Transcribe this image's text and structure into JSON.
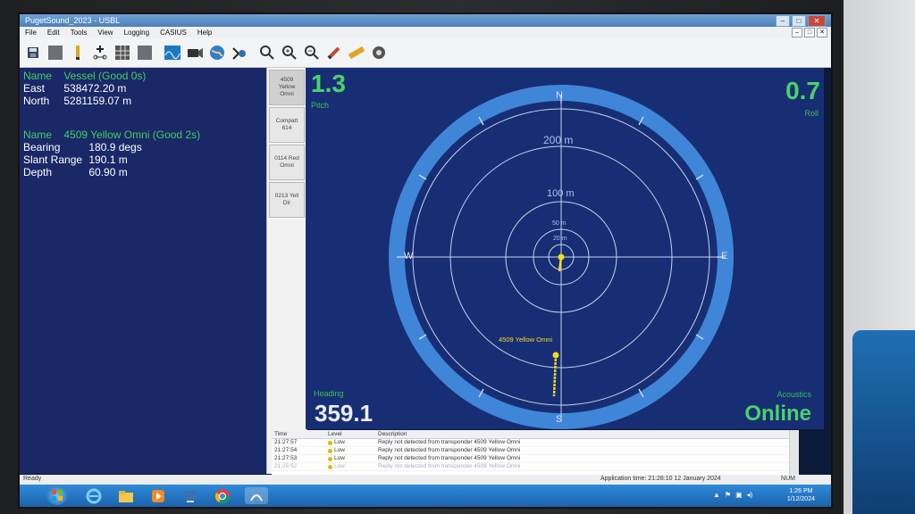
{
  "window": {
    "title": "PugetSound_2023 - USBL",
    "controls": {
      "minimize": "–",
      "maximize": "□",
      "close": "✕"
    }
  },
  "menu": [
    "File",
    "Edit",
    "Tools",
    "View",
    "Logging",
    "CASIUS",
    "Help"
  ],
  "toolbar_icons": [
    "save-icon",
    "blank-icon",
    "marker-icon",
    "add-node-icon",
    "grid-icon",
    "blank-icon",
    "wave-icon",
    "camera-icon",
    "globe-icon",
    "fish-icon",
    "zoom-in-icon",
    "zoom-fit-icon",
    "zoom-out-icon",
    "pen-icon",
    "ruler-icon",
    "target-icon"
  ],
  "vessel": {
    "name_label": "Name",
    "name_value": "Vessel (Good 0s)",
    "east_label": "East",
    "east_value": "538472.20 m",
    "north_label": "North",
    "north_value": "5281159.07 m"
  },
  "transponder": {
    "name_label": "Name",
    "name_value": "4509 Yellow Omni (Good 2s)",
    "bearing_label": "Bearing",
    "bearing_value": "180.9 degs",
    "slant_label": "Slant Range",
    "slant_value": "190.1 m",
    "depth_label": "Depth",
    "depth_value": "60.90 m"
  },
  "transponder_tabs": [
    {
      "line1": "4509",
      "line2": "Yellow",
      "line3": "Omni"
    },
    {
      "line1": "Compatt",
      "line2": "614",
      "line3": ""
    },
    {
      "line1": "0114 Red",
      "line2": "Omni",
      "line3": ""
    },
    {
      "line1": "0213 Yell",
      "line2": "Dir",
      "line3": ""
    }
  ],
  "readouts": {
    "pitch_value": "1.3",
    "pitch_label": "Pitch",
    "roll_value": "0.7",
    "roll_label": "Roll",
    "heading_label": "Heading",
    "heading_value": "359.1",
    "acoustics_label": "Acoustics",
    "acoustics_value": "Online"
  },
  "compass": {
    "n": "N",
    "s": "S",
    "e": "E",
    "w": "W",
    "ring_labels": [
      "200 m",
      "100 m",
      "50 m",
      "20 m"
    ],
    "target_label": "4509 Yellow Omni",
    "colors": {
      "ring": "#3f86d8",
      "background": "#182e74",
      "target": "#f2dc18"
    }
  },
  "log": {
    "headers": {
      "time": "Time",
      "level": "Level",
      "description": "Description"
    },
    "rows": [
      {
        "time": "21:27:57",
        "level": "Low",
        "description": "Reply not detected from transponder 4509 Yellow Omni"
      },
      {
        "time": "21:27:54",
        "level": "Low",
        "description": "Reply not detected from transponder 4509 Yellow Omni"
      },
      {
        "time": "21:27:53",
        "level": "Low",
        "description": "Reply not detected from transponder 4509 Yellow Omni"
      },
      {
        "time": "21:25:52",
        "level": "Low",
        "description": "Reply not detected from transponder 4509 Yellow Omni"
      }
    ]
  },
  "status": {
    "left": "Ready",
    "app_time": "Application time: 21:28:10   12 January 2024",
    "num": "NUM"
  },
  "taskbar": {
    "clock_time": "1:26 PM",
    "clock_date": "1/12/2024"
  }
}
